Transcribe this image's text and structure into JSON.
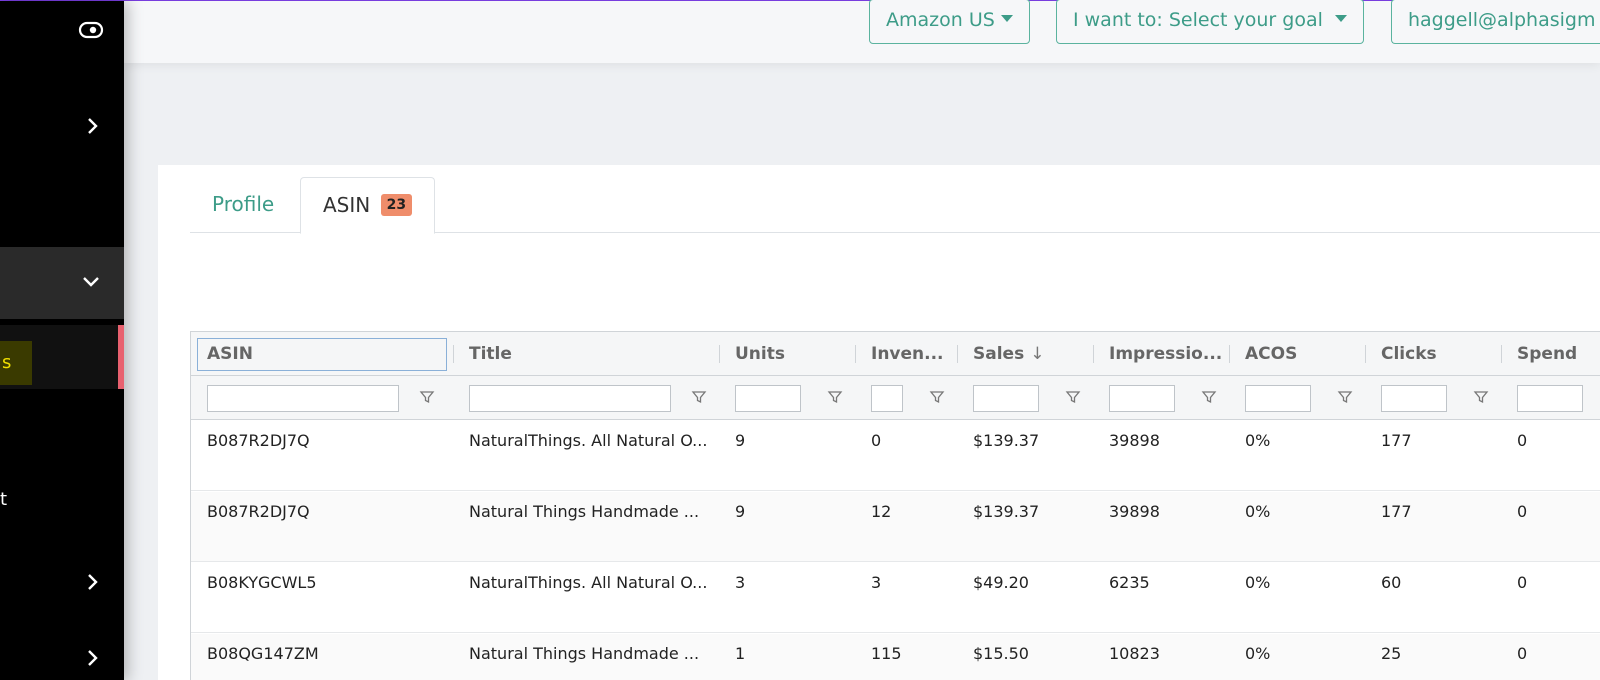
{
  "topbar": {
    "marketplace": "Amazon US",
    "goal": "I want to: Select your goal",
    "account": "haggell@alphasigm"
  },
  "sidebar": {
    "items": [
      {
        "icon": "eye-toggle-icon"
      },
      {
        "icon": "chevron-right-icon"
      },
      {
        "icon": "chevron-down-icon"
      },
      {
        "label": "s"
      },
      {
        "label": "t"
      },
      {
        "icon": "chevron-right-icon"
      },
      {
        "icon": "chevron-right-icon"
      }
    ]
  },
  "tabs": [
    {
      "label": "Profile"
    },
    {
      "label": "ASIN",
      "badge": "23"
    }
  ],
  "grid": {
    "columns": [
      "ASIN",
      "Title",
      "Units",
      "Inven...",
      "Sales",
      "Impressio...",
      "ACOS",
      "Clicks",
      "Spend"
    ],
    "sort_indicator": "↓",
    "rows": [
      [
        "B087R2DJ7Q",
        "NaturalThings. All Natural O...",
        "9",
        "0",
        "$139.37",
        "39898",
        "0%",
        "177",
        "0"
      ],
      [
        "B087R2DJ7Q",
        "Natural Things Handmade ...",
        "9",
        "12",
        "$139.37",
        "39898",
        "0%",
        "177",
        "0"
      ],
      [
        "B08KYGCWL5",
        "NaturalThings. All Natural O...",
        "3",
        "3",
        "$49.20",
        "6235",
        "0%",
        "60",
        "0"
      ],
      [
        "B08QG147ZM",
        "Natural Things Handmade ...",
        "1",
        "115",
        "$15.50",
        "10823",
        "0%",
        "25",
        "0"
      ]
    ]
  },
  "colors": {
    "accent": "#3d9c88",
    "badge": "#ef8d6b",
    "active_bar": "#e8616f",
    "sidebar_bg": "#000000"
  }
}
